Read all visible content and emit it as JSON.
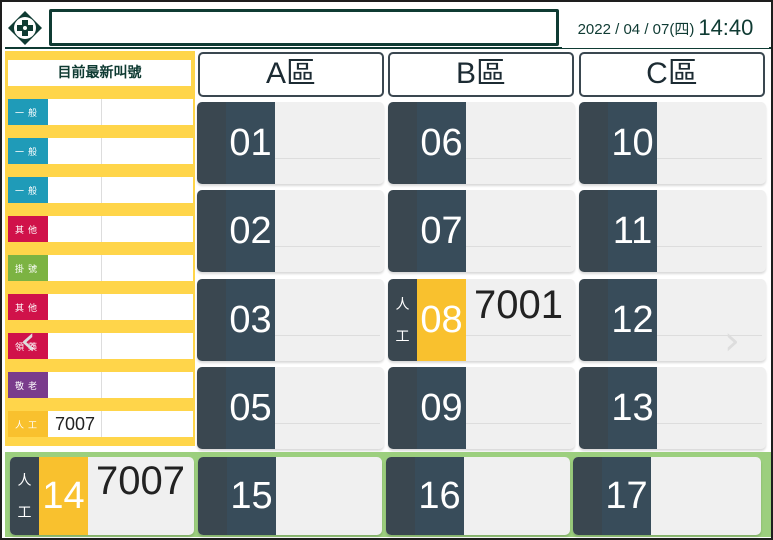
{
  "header": {
    "marquee_text": "",
    "date": "2022 / 04 / 07(四)",
    "time": "14:40"
  },
  "left_panel": {
    "title": "目前最新叫號",
    "rows": [
      {
        "tag": "一般",
        "value": ""
      },
      {
        "tag": "一般",
        "value": ""
      },
      {
        "tag": "一般",
        "value": ""
      },
      {
        "tag": "其他",
        "value": ""
      },
      {
        "tag": "掛號",
        "value": ""
      },
      {
        "tag": "其他",
        "value": ""
      },
      {
        "tag": "領藥",
        "value": ""
      },
      {
        "tag": "敬老",
        "value": ""
      },
      {
        "tag": "人工",
        "value": "7007"
      }
    ]
  },
  "zones": [
    {
      "label": "A區"
    },
    {
      "label": "B區"
    },
    {
      "label": "C區"
    }
  ],
  "counters": {
    "c01": {
      "number": "01",
      "side": "",
      "call": ""
    },
    "c02": {
      "number": "02",
      "side": "",
      "call": ""
    },
    "c03": {
      "number": "03",
      "side": "",
      "call": ""
    },
    "c05": {
      "number": "05",
      "side": "",
      "call": ""
    },
    "c06": {
      "number": "06",
      "side": "",
      "call": ""
    },
    "c07": {
      "number": "07",
      "side": "",
      "call": ""
    },
    "c08": {
      "number": "08",
      "side_top": "人",
      "side_bottom": "工",
      "call": "7001"
    },
    "c09": {
      "number": "09",
      "side": "",
      "call": ""
    },
    "c10": {
      "number": "10",
      "side": "",
      "call": ""
    },
    "c11": {
      "number": "11",
      "side": "",
      "call": ""
    },
    "c12": {
      "number": "12",
      "side": "",
      "call": ""
    },
    "c13": {
      "number": "13",
      "side": "",
      "call": ""
    },
    "c14": {
      "number": "14",
      "side_top": "人",
      "side_bottom": "工",
      "call": "7007"
    },
    "c15": {
      "number": "15",
      "side": "",
      "call": ""
    },
    "c16": {
      "number": "16",
      "side": "",
      "call": ""
    },
    "c17": {
      "number": "17",
      "side": "",
      "call": ""
    }
  },
  "nav": {
    "prev": "‹",
    "next": "›"
  },
  "colors": {
    "brand_dark": "#0f3b33",
    "panel_yellow": "#ffd54a",
    "highlight": "#f9c12e",
    "counter_dark": "#3a4750",
    "counter_num": "#384c5a",
    "active_band": "#9ccf7e",
    "tag_general": "#1f9bb8",
    "tag_other": "#d0124a",
    "tag_register": "#7cb342",
    "tag_medicine": "#d0124a",
    "tag_elder": "#7a3b8c",
    "tag_manual": "#f9c12e"
  }
}
